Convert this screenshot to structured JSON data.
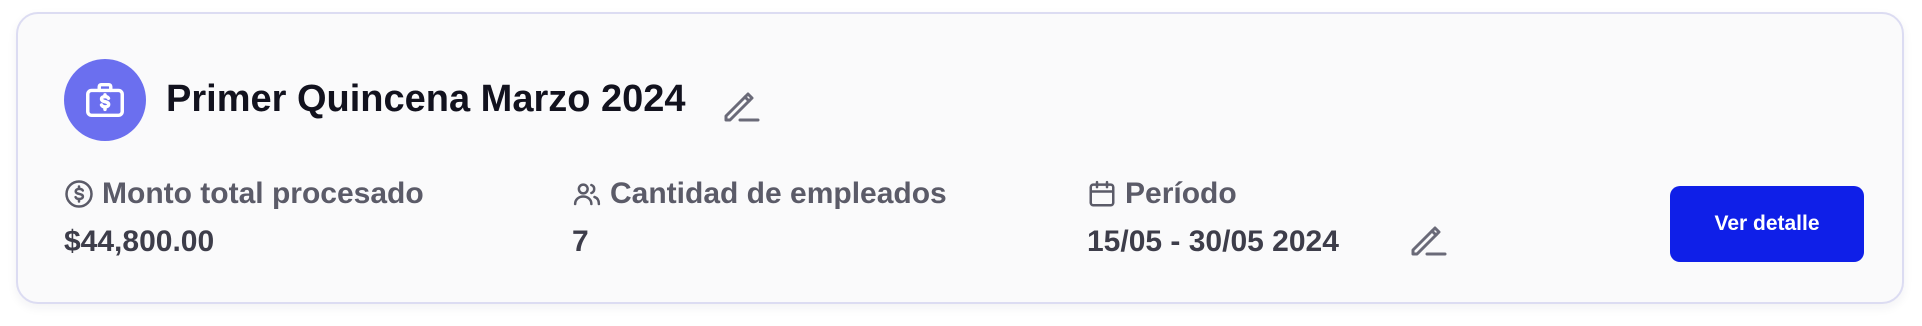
{
  "payroll": {
    "title": "Primer Quincena Marzo 2024",
    "icon": "briefcase-dollar-icon",
    "total": {
      "label": "Monto total procesado",
      "value": "$44,800.00",
      "icon": "dollar-circle-icon"
    },
    "employees": {
      "label": "Cantidad de empleados",
      "value": "7",
      "icon": "users-icon"
    },
    "period": {
      "label": "Período",
      "value": "15/05 - 30/05 2024",
      "icon": "calendar-icon"
    },
    "detail_button_label": "Ver detalle"
  },
  "colors": {
    "accent": "#0f1fe8",
    "avatar_bg": "#6b6fef",
    "title_text": "#12121e",
    "label_text": "#5b5b68",
    "card_border": "#dcdcf2"
  }
}
